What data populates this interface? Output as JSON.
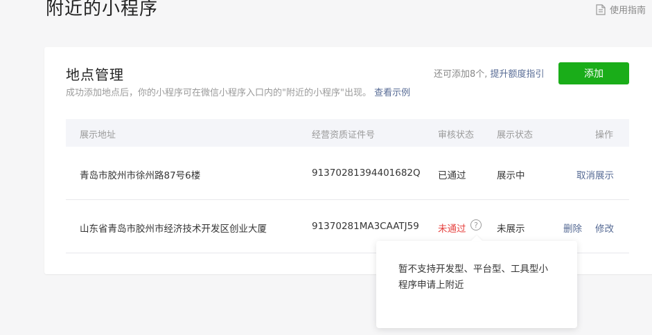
{
  "page": {
    "title": "附近的小程序",
    "guide_label": "使用指南"
  },
  "card": {
    "title": "地点管理",
    "description": "成功添加地点后，你的小程序可在微信小程序入口内的\"附近的小程序\"出现。",
    "description_link": "查看示例",
    "quota_text": "还可添加8个,",
    "quota_link": "提升额度指引",
    "add_button": "添加"
  },
  "table": {
    "headers": {
      "address": "展示地址",
      "license": "经营资质证件号",
      "review": "审核状态",
      "display": "展示状态",
      "actions": "操作"
    },
    "rows": [
      {
        "address": "青岛市胶州市徐州路87号6楼",
        "license": "91370281394401682Q",
        "review": "已通过",
        "display": "展示中",
        "action": "取消展示"
      },
      {
        "address": "山东省青岛市胶州市经济技术开发区创业大厦",
        "license": "91370281MA3CAATJ59",
        "review": "未通过",
        "help": "?",
        "display": "未展示",
        "action_delete": "删除",
        "action_edit": "修改"
      }
    ]
  },
  "tooltip": {
    "text": "暂不支持开发型、平台型、工具型小程序申请上附近"
  },
  "colors": {
    "primary_green": "#1aad19",
    "link_blue": "#576b95",
    "fail_red": "#e64340"
  }
}
